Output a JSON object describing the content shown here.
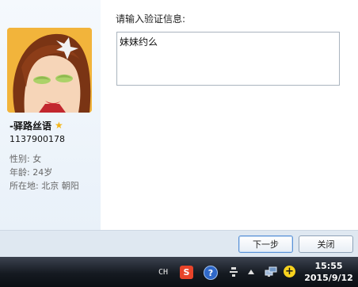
{
  "profile": {
    "nickname": "-驿路丝语",
    "qq_number": "1137900178",
    "gender": "性别: 女",
    "age": "年龄: 24岁",
    "location": "所在地: 北京  朝阳"
  },
  "verify": {
    "prompt": "请输入验证信息:",
    "message": "妹妹约么"
  },
  "buttons": {
    "next": "下一步",
    "close": "关闭"
  },
  "taskbar": {
    "ime": "CH",
    "sogou": "S",
    "help": "?",
    "clock_time": "15:55",
    "clock_date": "2015/9/12"
  },
  "icons": [
    "avatar",
    "star-icon",
    "sogou-icon",
    "help-icon",
    "tray-misc-icon",
    "up-arrow-icon",
    "network-icon",
    "plus-icon"
  ],
  "colors": {
    "accent": "#5b92d6",
    "footer": "#dfe8f1",
    "taskbar": "#151a21",
    "star": "#f3b51a"
  }
}
